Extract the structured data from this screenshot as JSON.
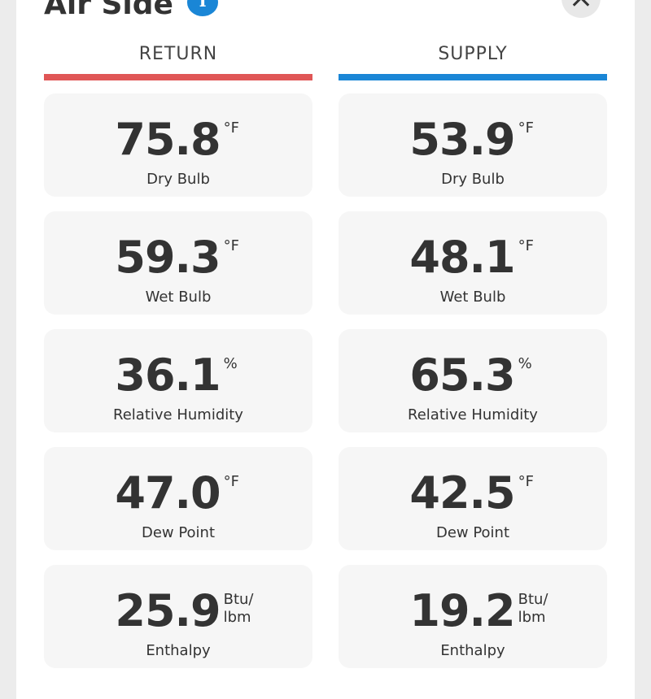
{
  "header": {
    "title": "Air Side",
    "info_icon": "info-icon",
    "close_icon": "close-icon"
  },
  "colors": {
    "return_accent": "#e05656",
    "supply_accent": "#1a86d6",
    "card_bg": "#f6f6f6"
  },
  "columns": {
    "return": {
      "label": "RETURN",
      "cards": [
        {
          "value": "75.8",
          "unit": "°F",
          "label": "Dry Bulb"
        },
        {
          "value": "59.3",
          "unit": "°F",
          "label": "Wet Bulb"
        },
        {
          "value": "36.1",
          "unit": "%",
          "label": "Relative Humidity"
        },
        {
          "value": "47.0",
          "unit": "°F",
          "label": "Dew Point"
        },
        {
          "value": "25.9",
          "unit": "Btu/ lbm",
          "label": "Enthalpy"
        }
      ]
    },
    "supply": {
      "label": "SUPPLY",
      "cards": [
        {
          "value": "53.9",
          "unit": "°F",
          "label": "Dry Bulb"
        },
        {
          "value": "48.1",
          "unit": "°F",
          "label": "Wet Bulb"
        },
        {
          "value": "65.3",
          "unit": "%",
          "label": "Relative Humidity"
        },
        {
          "value": "42.5",
          "unit": "°F",
          "label": "Dew Point"
        },
        {
          "value": "19.2",
          "unit": "Btu/ lbm",
          "label": "Enthalpy"
        }
      ]
    }
  }
}
